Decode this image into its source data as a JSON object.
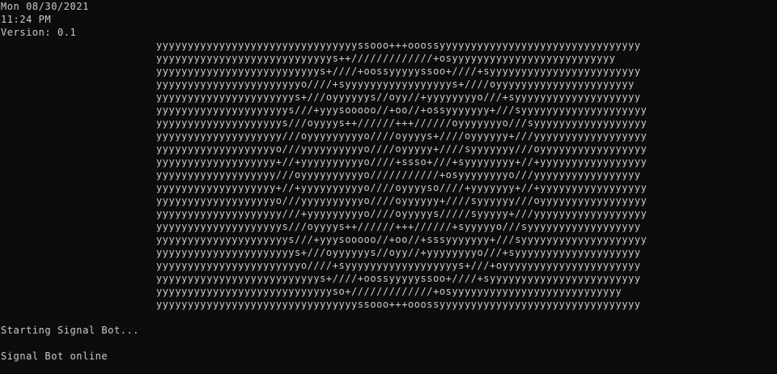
{
  "header": {
    "date": "Mon 08/30/2021",
    "time": "11:24 PM",
    "version": "Version: 0.1"
  },
  "ascii_art": [
    "yyyyyyyyyyyyyyyyyyyyyyyyyyyyyyyyssooo+++ooossyyyyyyyyyyyyyyyyyyyyyyyyyyyyyyyy",
    "yyyyyyyyyyyyyyyyyyyyyyyyyyyys++/////////////+osyyyyyyyyyyyyyyyyyyyyyyyyyy",
    "yyyyyyyyyyyyyyyyyyyyyyyyyys+////+oossyyyyyssoo+////+syyyyyyyyyyyyyyyyyyyyyyyy",
    "yyyyyyyyyyyyyyyyyyyyyyyo////+syyyyyyyyyyyyyyyyys+////oyyyyyyyyyyyyyyyyyyyyyy",
    "yyyyyyyyyyyyyyyyyyyyyys+///oyyyyyys//oyy//+yyyyyyyyo///+syyyyyyyyyyyyyyyyyyyy",
    "yyyyyyyyyyyyyyyyyyyyys///+yyysooooo//+oo//+ossyyyyyyy+///syyyyyyyyyyyyyyyyyyyy",
    "yyyyyyyyyyyyyyyyyyyys///oyyyys++//////+++//////oyyyyyyyo///syyyyyyyyyyyyyyyyyy",
    "yyyyyyyyyyyyyyyyyyyy///oyyyyyyyyyo////oyyyys+////oyyyyyy+///yyyyyyyyyyyyyyyyyy",
    "yyyyyyyyyyyyyyyyyyyo///yyyyyyyyyyo////oyyyyy+////syyyyyyy///oyyyyyyyyyyyyyyyyy",
    "yyyyyyyyyyyyyyyyyyy+//+yyyyyyyyyyo////+ssso+///+syyyyyyyy+//+yyyyyyyyyyyyyyyyy",
    "yyyyyyyyyyyyyyyyyyy///oyyyyyyyyyyo///////////+osyyyyyyyyo///yyyyyyyyyyyyyyyyy",
    "yyyyyyyyyyyyyyyyyyy+//+yyyyyyyyyyo////oyyyyso////+yyyyyyy+//+yyyyyyyyyyyyyyyyy",
    "yyyyyyyyyyyyyyyyyyyo///yyyyyyyyyyo////oyyyyyy+////syyyyyy///oyyyyyyyyyyyyyyyyy",
    "yyyyyyyyyyyyyyyyyyyy///+yyyyyyyyyo////oyyyyys/////syyyyy+///yyyyyyyyyyyyyyyyyy",
    "yyyyyyyyyyyyyyyyyyyys///oyyyys++//////+++//////+syyyyyo///syyyyyyyyyyyyyyyyyy",
    "yyyyyyyyyyyyyyyyyyyyys///+yyysooooo//+oo//+sssyyyyyyy+///syyyyyyyyyyyyyyyyyyyy",
    "yyyyyyyyyyyyyyyyyyyyyys+///oyyyyyys//oyy//+yyyyyyyyo///+syyyyyyyyyyyyyyyyyyyy",
    "yyyyyyyyyyyyyyyyyyyyyyyo////+syyyyyyyyyyyyyyyyyys+///+oyyyyyyyyyyyyyyyyyyyyyy",
    "yyyyyyyyyyyyyyyyyyyyyyyyyys+////+oossyyyyyssoo+////+syyyyyyyyyyyyyyyyyyyyyyyy",
    "yyyyyyyyyyyyyyyyyyyyyyyyyyyyso+/////////////+osyyyyyyyyyyyyyyyyyyyyyyyyyyy",
    "yyyyyyyyyyyyyyyyyyyyyyyyyyyyyyyyssooo+++ooossyyyyyyyyyyyyyyyyyyyyyyyyyyyyyyyy"
  ],
  "status": {
    "starting": "Starting Signal Bot...",
    "online": "Signal Bot online"
  }
}
